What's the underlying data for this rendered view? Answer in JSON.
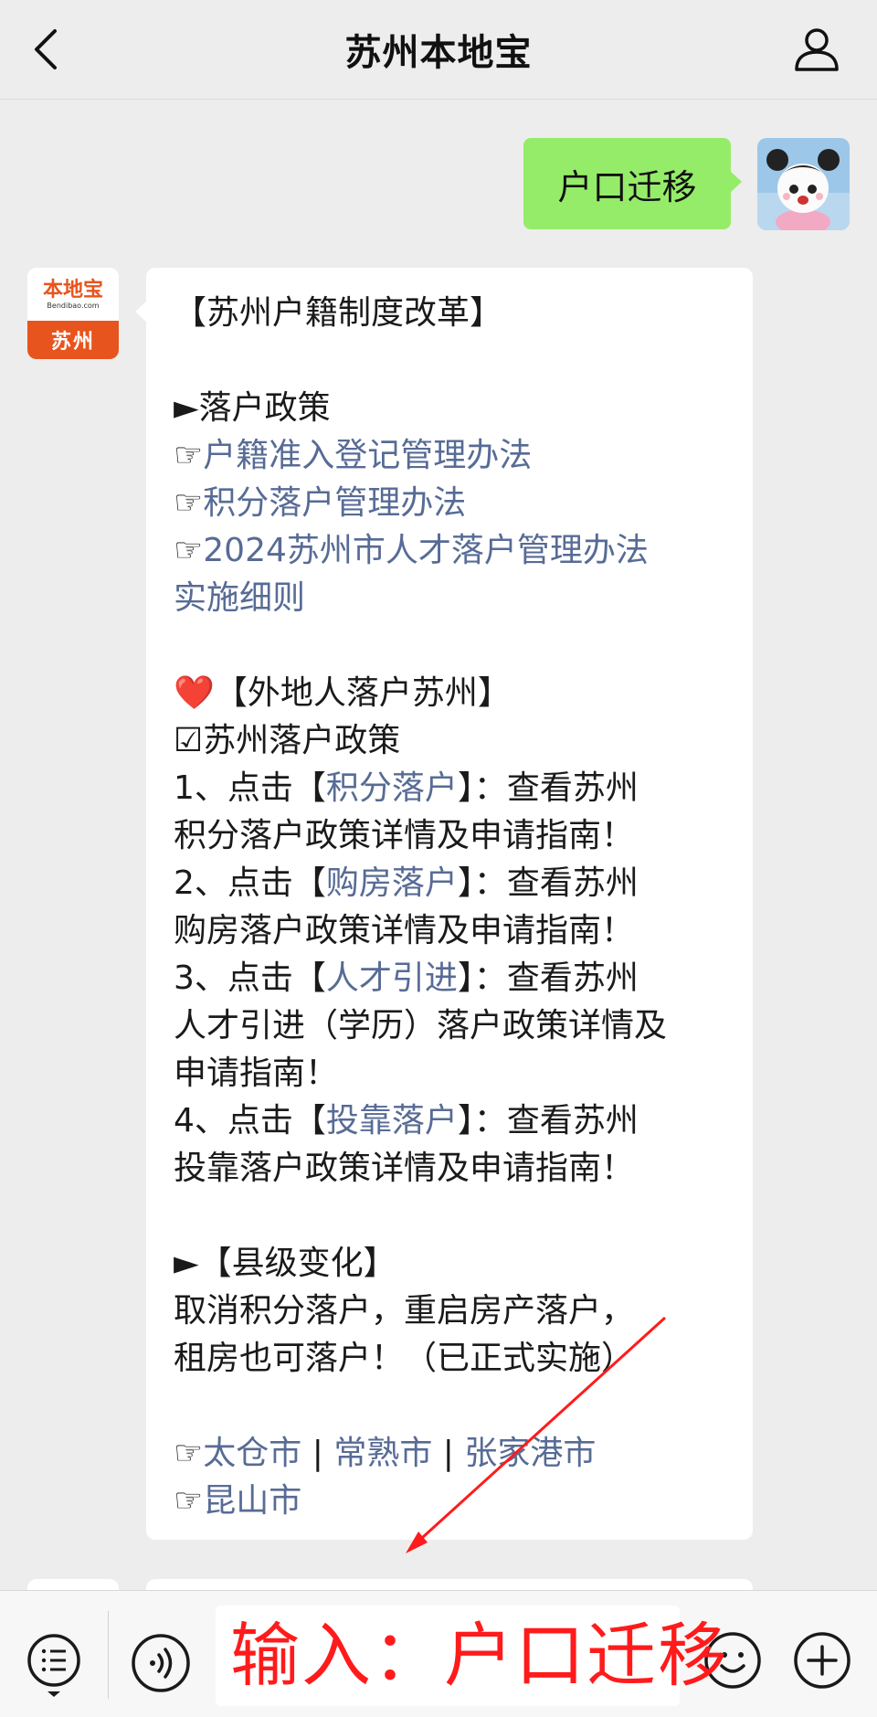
{
  "header": {
    "title": "苏州本地宝"
  },
  "my_message": {
    "text": "户口迁移"
  },
  "bot": {
    "avatar_brand": "本地宝",
    "avatar_site": "Bendibao.com",
    "avatar_city": "苏州"
  },
  "message": {
    "title": "【苏州户籍制度改革】",
    "section1": "►落户政策",
    "links1": [
      "户籍准入登记管理办法",
      "积分落户管理办法",
      "2024苏州市人才落户管理办法",
      "实施细则"
    ],
    "pointer_icon": "☞",
    "heart_icon": "❤️",
    "section2": "【外地人落户苏州】",
    "sub2": "☑苏州落户政策",
    "items": [
      {
        "prefix": "1、点击【",
        "link": "积分落户",
        "suffix": "】：查看苏州",
        "line2": "积分落户政策详情及申请指南！",
        "line3": ""
      },
      {
        "prefix": "2、点击【",
        "link": "购房落户",
        "suffix": "】：查看苏州",
        "line2": "购房落户政策详情及申请指南！",
        "line3": ""
      },
      {
        "prefix": "3、点击【",
        "link": "人才引进",
        "suffix": "】：查看苏州",
        "line2": "人才引进（学历）落户政策详情及",
        "line3": "申请指南！"
      },
      {
        "prefix": "4、点击【",
        "link": "投靠落户",
        "suffix": "】：查看苏州",
        "line2": "投靠落户政策详情及申请指南！",
        "line3": ""
      }
    ],
    "section3": "►【县级变化】",
    "change_line1": "取消积分落户，重启房产落户，",
    "change_line2": "租房也可落户！（已正式实施）",
    "cities": [
      "太仓市",
      "常熟市",
      "张家港市",
      "昆山市"
    ],
    "separator": " | "
  },
  "annotation": {
    "text": "输入：户口迁移",
    "color": "#ff1b1b"
  },
  "colors": {
    "link": "#576b95",
    "my_bubble": "#95ec69",
    "background": "#ededed",
    "brand": "#e8541e"
  }
}
